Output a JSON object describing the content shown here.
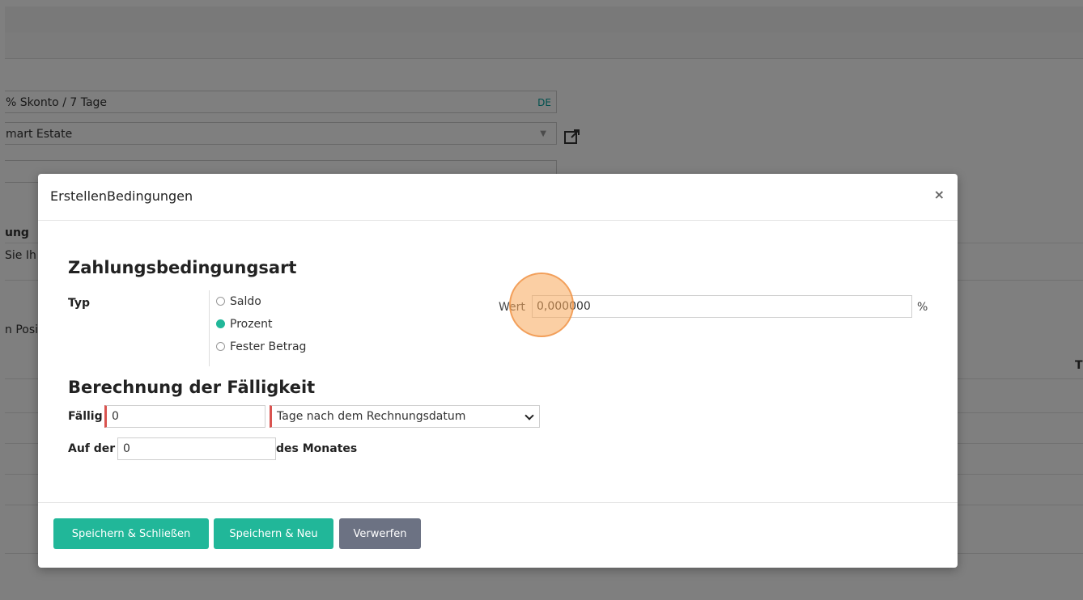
{
  "background": {
    "fields": [
      {
        "value": "% Skonto / 7 Tage",
        "lang": "DE"
      },
      {
        "value": "mart Estate"
      },
      {
        "value": ""
      }
    ],
    "fragments": [
      "ung",
      "Sie Ih",
      "n Posi",
      "T"
    ]
  },
  "modal": {
    "title": "ErstellenBedingungen",
    "close": "×",
    "section1_title": "Zahlungsbedingungsart",
    "typ_label": "Typ",
    "radio_options": [
      {
        "label": "Saldo",
        "checked": false
      },
      {
        "label": "Prozent",
        "checked": true
      },
      {
        "label": "Fester Betrag",
        "checked": false
      }
    ],
    "wert_label": "Wert",
    "wert_value": "0,000000",
    "wert_unit": "%",
    "section2_title": "Berechnung der Fälligkeit",
    "faellig_label": "Fällig",
    "faellig_value": "0",
    "faellig_option": "Tage nach dem Rechnungsdatum",
    "aufder_label": "Auf der",
    "aufder_value": "0",
    "des_monates": "des Monates",
    "buttons": {
      "save_close": "Speichern & Schließen",
      "save_new": "Speichern & Neu",
      "discard": "Verwerfen"
    }
  },
  "colors": {
    "primary": "#21b799",
    "secondary": "#6c7283",
    "required": "#d9534f",
    "click_highlight": "#f8a85a"
  }
}
